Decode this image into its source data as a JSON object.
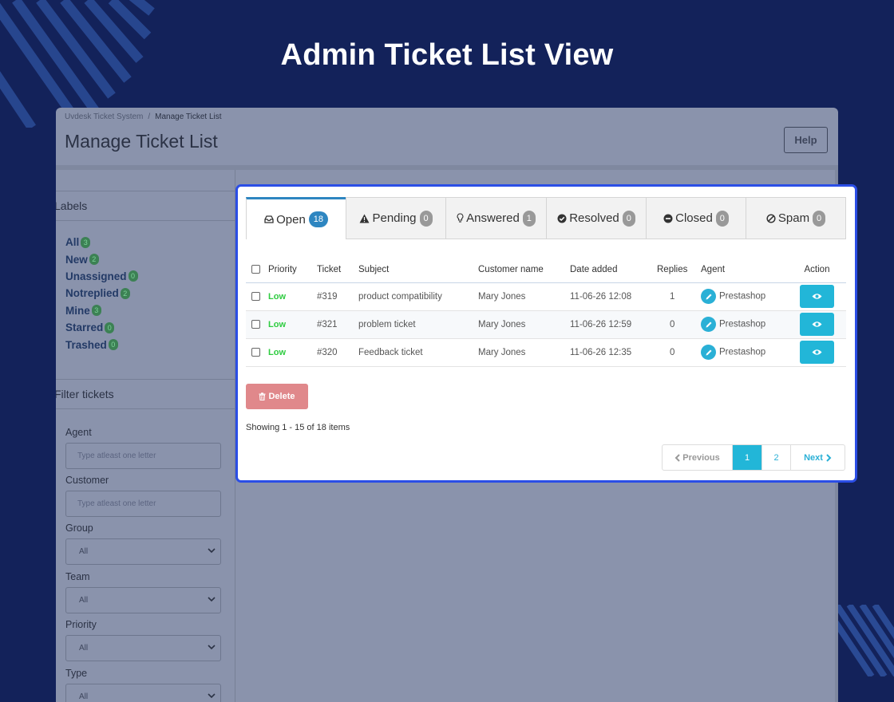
{
  "hero": {
    "title": "Admin Ticket List View"
  },
  "app": {
    "breadcrumb": {
      "root": "Uvdesk Ticket System",
      "separator": "/",
      "current": "Manage Ticket List"
    },
    "page_title": "Manage Ticket List",
    "help_label": "Help"
  },
  "sidebar": {
    "labels_heading": "Labels",
    "labels": [
      {
        "label": "All",
        "count": "3"
      },
      {
        "label": "New",
        "count": "2"
      },
      {
        "label": "Unassigned",
        "count": "0"
      },
      {
        "label": "Notreplied",
        "count": "2"
      },
      {
        "label": "Mine",
        "count": "3"
      },
      {
        "label": "Starred",
        "count": "0"
      },
      {
        "label": "Trashed",
        "count": "0"
      }
    ],
    "filter_heading": "Filter tickets",
    "filters": {
      "agent": {
        "label": "Agent",
        "placeholder": "Type atleast one letter"
      },
      "customer": {
        "label": "Customer",
        "placeholder": "Type atleast one letter"
      },
      "group": {
        "label": "Group",
        "value": "All"
      },
      "team": {
        "label": "Team",
        "value": "All"
      },
      "priority": {
        "label": "Priority",
        "value": "All"
      },
      "type": {
        "label": "Type",
        "value": "All"
      }
    }
  },
  "tabs": [
    {
      "label": "Open",
      "count": "18",
      "icon": "inbox-icon"
    },
    {
      "label": "Pending",
      "count": "0",
      "icon": "warning-icon"
    },
    {
      "label": "Answered",
      "count": "1",
      "icon": "lightbulb-icon"
    },
    {
      "label": "Resolved",
      "count": "0",
      "icon": "check-circle-icon"
    },
    {
      "label": "Closed",
      "count": "0",
      "icon": "minus-circle-icon"
    },
    {
      "label": "Spam",
      "count": "0",
      "icon": "ban-icon"
    }
  ],
  "table": {
    "columns": {
      "priority": "Priority",
      "ticket": "Ticket",
      "subject": "Subject",
      "customer": "Customer name",
      "date": "Date added",
      "replies": "Replies",
      "agent": "Agent",
      "action": "Action"
    },
    "rows": [
      {
        "priority": "Low",
        "ticket": "#319",
        "subject": "product compatibility",
        "customer": "Mary Jones",
        "date": "11-06-26 12:08",
        "replies": "1",
        "agent": "Prestashop"
      },
      {
        "priority": "Low",
        "ticket": "#321",
        "subject": "problem ticket",
        "customer": "Mary Jones",
        "date": "11-06-26 12:59",
        "replies": "0",
        "agent": "Prestashop"
      },
      {
        "priority": "Low",
        "ticket": "#320",
        "subject": "Feedback ticket",
        "customer": "Mary Jones",
        "date": "11-06-26 12:35",
        "replies": "0",
        "agent": "Prestashop"
      }
    ]
  },
  "actions": {
    "delete_label": "Delete"
  },
  "footer": {
    "showing": "Showing 1 - 15 of 18 items",
    "pagination": {
      "previous": "Previous",
      "pages": [
        "1",
        "2"
      ],
      "next": "Next",
      "current": "1"
    }
  },
  "colors": {
    "background": "#13225a",
    "panel_border": "#2b4ee6",
    "accent": "#22b6d8",
    "priority_low": "#2ecc40",
    "delete": "#e0888b"
  }
}
